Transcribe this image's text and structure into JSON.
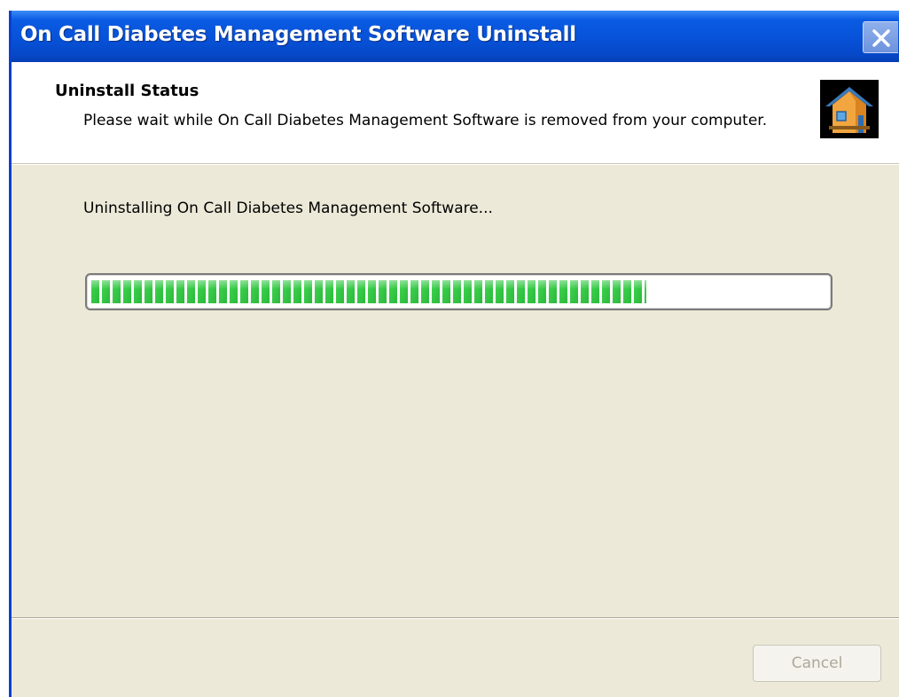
{
  "window": {
    "title": "On Call Diabetes Management Software Uninstall"
  },
  "header": {
    "title": "Uninstall Status",
    "description": "Please wait while On Call Diabetes Management Software is removed from your computer.",
    "icon": "installer-house-icon"
  },
  "main": {
    "status_text": "Uninstalling On Call Diabetes Management Software...",
    "progress_fraction": 0.755
  },
  "footer": {
    "cancel_label": "Cancel",
    "cancel_enabled": false
  },
  "colors": {
    "titlebar": "#0752d8",
    "dialog_background": "#ece9d8",
    "progress_green": "#2fc240"
  }
}
